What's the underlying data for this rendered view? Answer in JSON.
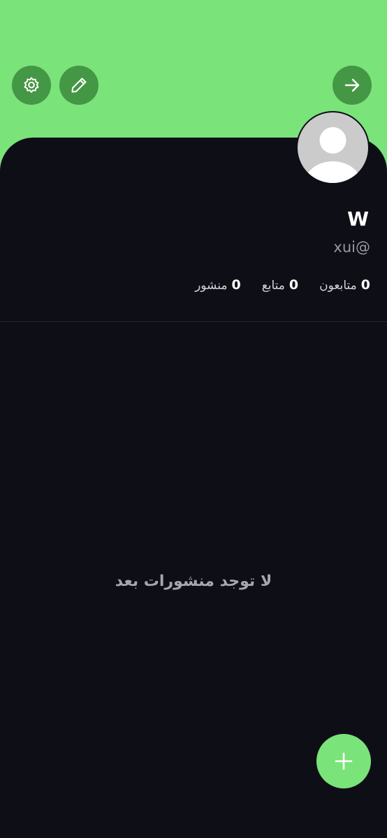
{
  "colors": {
    "header_background": "#7ae37a",
    "icon_button_background": "#449744",
    "page_background": "#0e0e17",
    "fab_background": "#7ae37a",
    "avatar_placeholder": "#cbcbcb"
  },
  "header": {
    "buttons": [
      {
        "icon": "settings-gear-icon"
      },
      {
        "icon": "edit-pencil-icon"
      },
      {
        "icon": "arrow-right-icon"
      }
    ]
  },
  "profile": {
    "avatar_icon": "default-avatar-icon",
    "display_name": "W",
    "username": "xui@",
    "stats": [
      {
        "value": "0",
        "label": "متابعون"
      },
      {
        "value": "0",
        "label": "متابع"
      },
      {
        "value": "0",
        "label": "منشور"
      }
    ]
  },
  "feed": {
    "empty_message": "لا توجد منشورات بعد"
  },
  "fab": {
    "icon": "plus-icon"
  }
}
